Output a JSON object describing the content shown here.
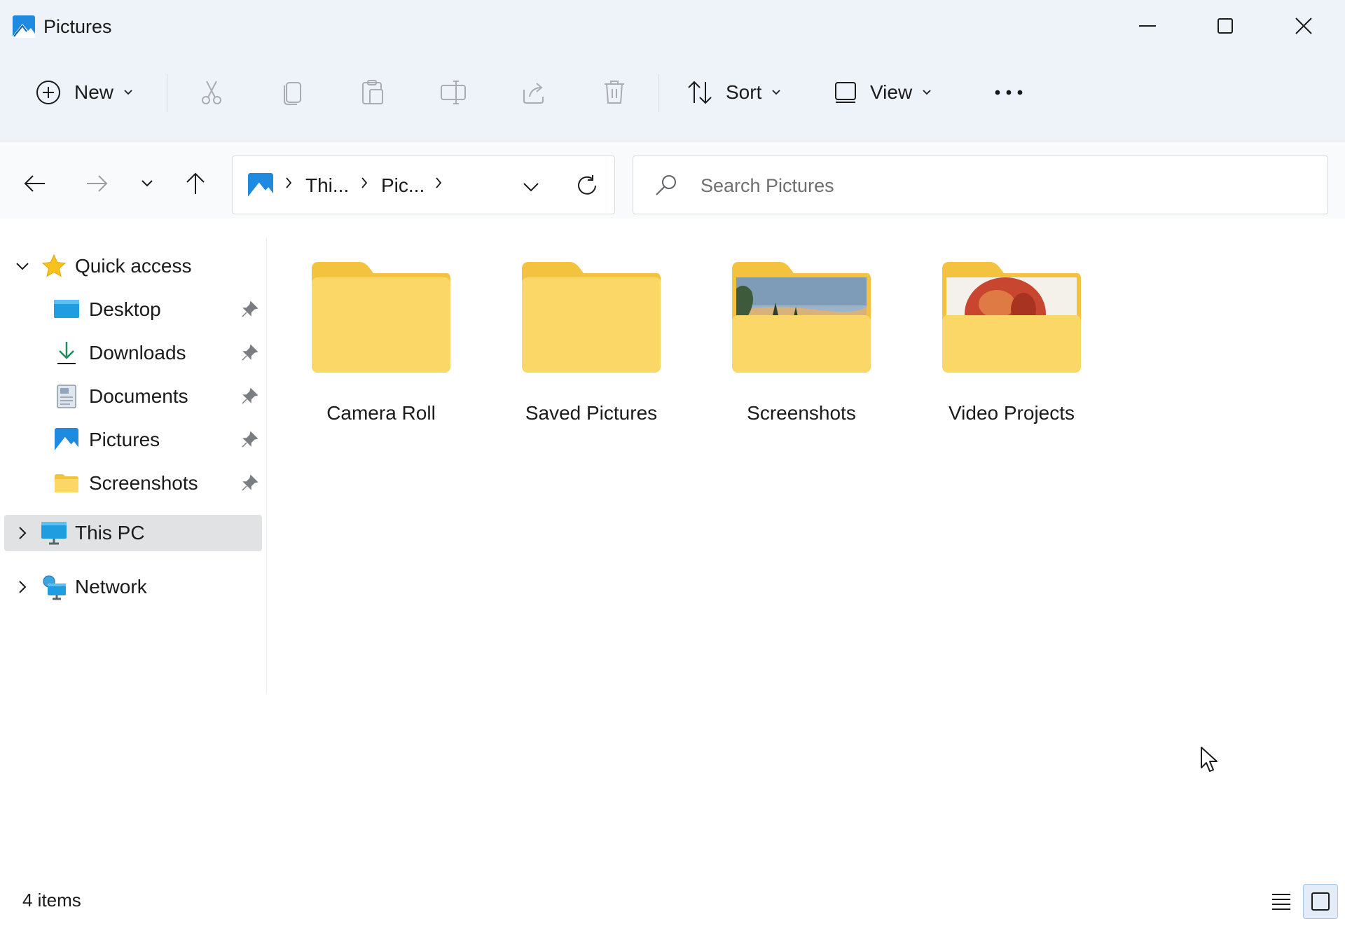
{
  "window": {
    "title": "Pictures",
    "controls": [
      "minimize",
      "maximize",
      "close"
    ]
  },
  "toolbar": {
    "new_label": "New",
    "sort_label": "Sort",
    "view_label": "View",
    "actions": [
      "cut-icon",
      "copy-icon",
      "paste-icon",
      "rename-icon",
      "share-icon",
      "delete-icon"
    ],
    "more_icon": "more-icon"
  },
  "navigation": {
    "breadcrumb": [
      "Thi...",
      "Pic..."
    ],
    "search_placeholder": "Search Pictures"
  },
  "sidebar": {
    "quick_access_label": "Quick access",
    "pinned": [
      {
        "label": "Desktop",
        "icon": "desktop-icon"
      },
      {
        "label": "Downloads",
        "icon": "download-icon"
      },
      {
        "label": "Documents",
        "icon": "documents-icon"
      },
      {
        "label": "Pictures",
        "icon": "pictures-icon"
      },
      {
        "label": "Screenshots",
        "icon": "folder-icon"
      }
    ],
    "this_pc_label": "This PC",
    "network_label": "Network",
    "selected": "This PC"
  },
  "content": {
    "folders": [
      {
        "name": "Camera Roll",
        "thumbnail": "none"
      },
      {
        "name": "Saved Pictures",
        "thumbnail": "none"
      },
      {
        "name": "Screenshots",
        "thumbnail": "landscape"
      },
      {
        "name": "Video Projects",
        "thumbnail": "apple"
      }
    ]
  },
  "statusbar": {
    "item_count": "4 items",
    "active_view": "large-icons"
  },
  "colors": {
    "chrome_bg": "#eef3f9",
    "folder_back": "#f3c33f",
    "folder_front": "#fbd768",
    "selected_bg": "#e1e2e4",
    "accent": "#0067c0"
  }
}
